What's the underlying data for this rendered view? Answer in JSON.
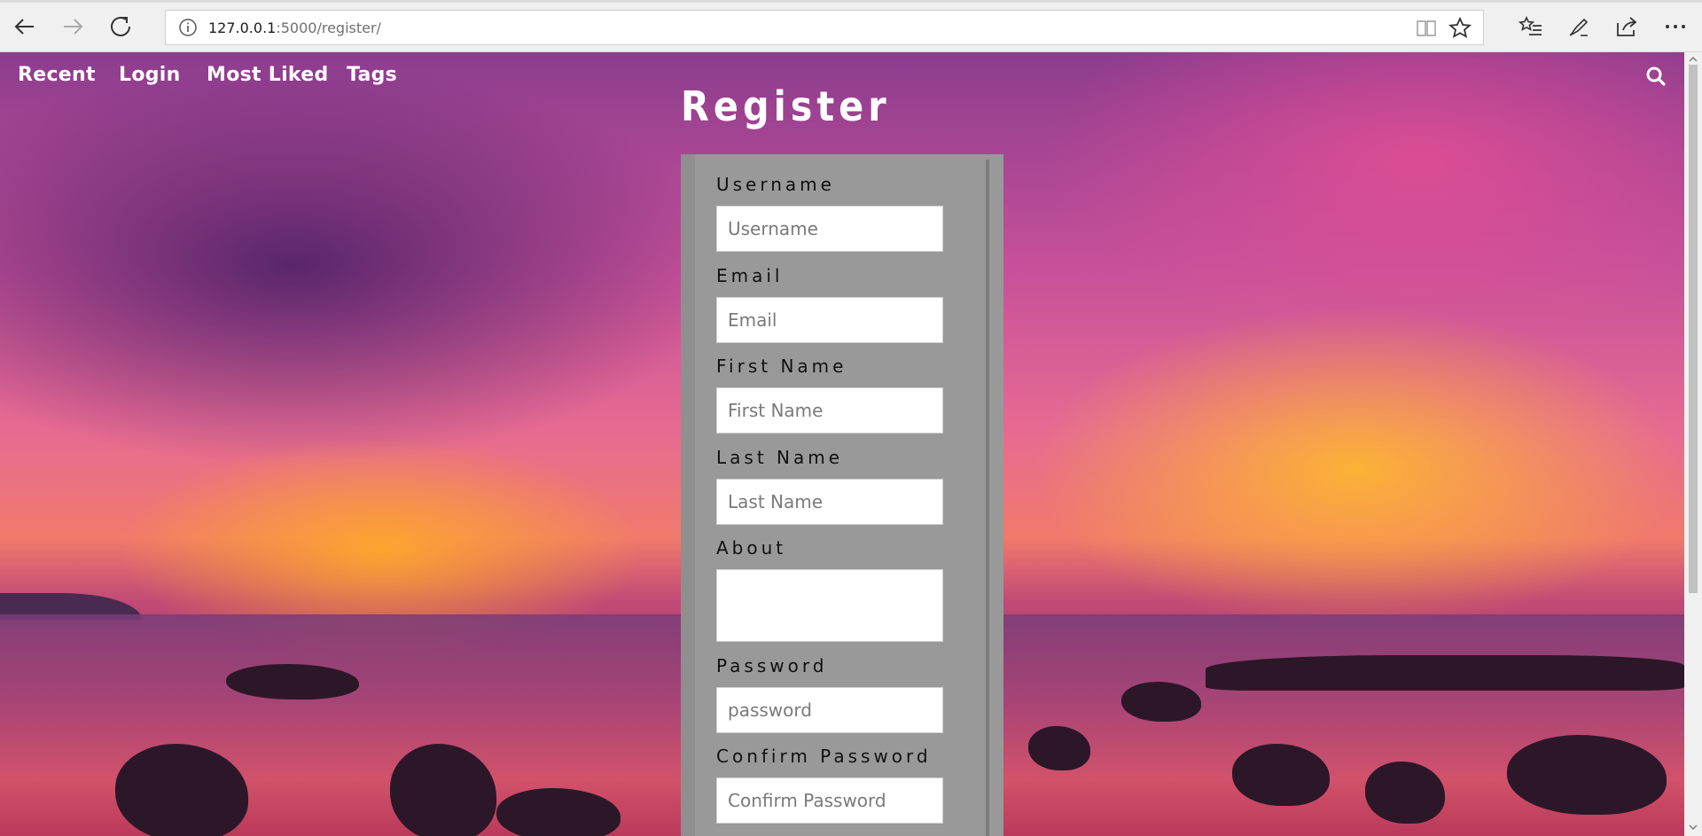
{
  "browser": {
    "url_host": "127.0.0.1",
    "url_path": ":5000/register/"
  },
  "nav": {
    "links": [
      "Recent",
      "Login",
      "Most Liked",
      "Tags"
    ]
  },
  "page": {
    "title": "Register"
  },
  "form": {
    "username": {
      "label": "Username",
      "placeholder": "Username"
    },
    "email": {
      "label": "Email",
      "placeholder": "Email"
    },
    "first_name": {
      "label": "First Name",
      "placeholder": "First Name"
    },
    "last_name": {
      "label": "Last Name",
      "placeholder": "Last Name"
    },
    "about": {
      "label": "About",
      "placeholder": ""
    },
    "password": {
      "label": "Password",
      "placeholder": "password"
    },
    "confirm_password": {
      "label": "Confirm Password",
      "placeholder": "Confirm Password"
    }
  },
  "icons": {
    "back": "back-arrow-icon",
    "forward": "forward-arrow-icon",
    "refresh": "refresh-icon",
    "info": "info-icon",
    "reading_view": "reading-view-icon",
    "favorite": "star-icon",
    "favorites_hub": "favorites-list-icon",
    "annotate": "pen-icon",
    "share": "share-icon",
    "more": "more-icon",
    "search": "search-icon"
  }
}
